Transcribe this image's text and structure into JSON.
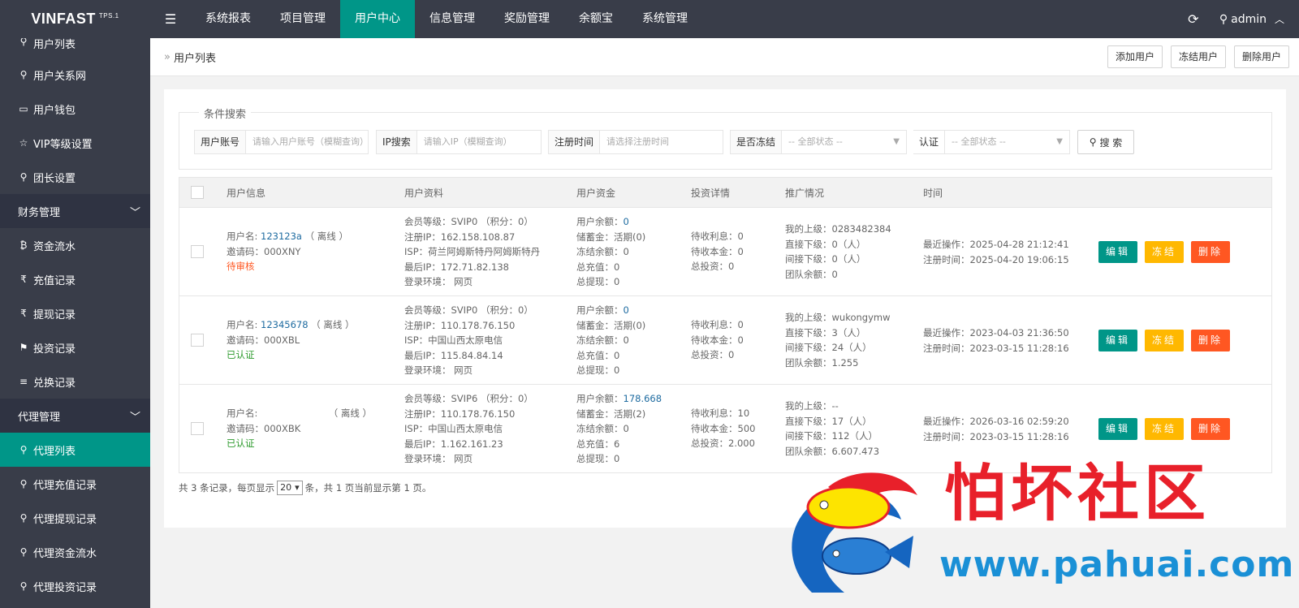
{
  "brand": {
    "name": "VINFAST",
    "version": "TPS.1"
  },
  "topnav": {
    "items": [
      "系统报表",
      "项目管理",
      "用户中心",
      "信息管理",
      "奖励管理",
      "余额宝",
      "系统管理"
    ],
    "active_index": 2,
    "user": "admin"
  },
  "sidebar": {
    "items": [
      {
        "label": "用户列表",
        "icon": "user-icon"
      },
      {
        "label": "用户关系网",
        "icon": "users-icon"
      },
      {
        "label": "用户钱包",
        "icon": "wallet-icon"
      },
      {
        "label": "VIP等级设置",
        "icon": "star-icon"
      },
      {
        "label": "团长设置",
        "icon": "users-icon"
      }
    ],
    "group1": "财务管理",
    "group1_items": [
      {
        "label": "资金流水",
        "icon": "bitcoin-icon"
      },
      {
        "label": "充值记录",
        "icon": "rupee-icon"
      },
      {
        "label": "提现记录",
        "icon": "rupee-icon"
      },
      {
        "label": "投资记录",
        "icon": "flag-icon"
      },
      {
        "label": "兑换记录",
        "icon": "list-icon"
      }
    ],
    "group2": "代理管理",
    "group2_items": [
      {
        "label": "代理列表",
        "icon": "user-icon"
      },
      {
        "label": "代理充值记录",
        "icon": "user-icon"
      },
      {
        "label": "代理提现记录",
        "icon": "user-icon"
      },
      {
        "label": "代理资金流水",
        "icon": "user-icon"
      },
      {
        "label": "代理投资记录",
        "icon": "user-icon"
      }
    ]
  },
  "breadcrumb": {
    "sep": "»",
    "current": "用户列表"
  },
  "actions": {
    "add": "添加用户",
    "freeze": "冻结用户",
    "delete": "删除用户"
  },
  "search": {
    "title": "条件搜索",
    "account_label": "用户账号",
    "account_placeholder": "请输入用户账号（模糊查询）",
    "ip_label": "IP搜索",
    "ip_placeholder": "请输入IP（模糊查询）",
    "regtime_label": "注册时间",
    "regtime_placeholder": "请选择注册时间",
    "frozen_label": "是否冻结",
    "frozen_value": "-- 全部状态 --",
    "auth_label": "认证",
    "auth_value": "-- 全部状态 --",
    "button": "搜 索"
  },
  "table": {
    "headers": [
      "用户信息",
      "用户资料",
      "用户资金",
      "投资详情",
      "推广情况",
      "时间"
    ],
    "rows": [
      {
        "user": {
          "name_label": "用户名:",
          "name": "123123a",
          "online": "（ 离线 ）",
          "invite": "邀请码：000XNY",
          "status": "待审核",
          "status_type": "warn"
        },
        "profile": [
          "会员等级：SVIP0 （积分：0）",
          "注册IP：162.158.108.87",
          "ISP：荷兰阿姆斯特丹阿姆斯特丹",
          "最后IP：172.71.82.138",
          "登录环境： 网页"
        ],
        "funds": {
          "balance_label": "用户余额：",
          "balance": "0",
          "lines": [
            "储蓄金：活期(0)",
            "冻结余额：0",
            "总充值：0",
            "总提现：0"
          ]
        },
        "invest": [
          "待收利息：0",
          "待收本金：0",
          "总投资：0"
        ],
        "promo": [
          "我的上级：0283482384",
          "直接下级：0（人）",
          "间接下级：0（人）",
          "团队余额：0"
        ],
        "time": [
          "最近操作：2025-04-28 21:12:41",
          "注册时间：2025-04-20 19:06:15"
        ]
      },
      {
        "user": {
          "name_label": "用户名:",
          "name": "12345678",
          "online": "（ 离线 ）",
          "invite": "邀请码：000XBL",
          "status": "已认证",
          "status_type": "ok"
        },
        "profile": [
          "会员等级：SVIP0 （积分：0）",
          "注册IP：110.178.76.150",
          "ISP：中国山西太原电信",
          "最后IP：115.84.84.14",
          "登录环境： 网页"
        ],
        "funds": {
          "balance_label": "用户余额：",
          "balance": "0",
          "lines": [
            "储蓄金：活期(0)",
            "冻结余额：0",
            "总充值：0",
            "总提现：0"
          ]
        },
        "invest": [
          "待收利息：0",
          "待收本金：0",
          "总投资：0"
        ],
        "promo": [
          "我的上级：wukongymw",
          "直接下级：3（人）",
          "间接下级：24（人）",
          "团队余额：1.255"
        ],
        "time": [
          "最近操作：2023-04-03 21:36:50",
          "注册时间：2023-03-15 11:28:16"
        ]
      },
      {
        "user": {
          "name_label": "用户名:",
          "name": "",
          "online": "（ 离线 ）",
          "invite": "邀请码：000XBK",
          "status": "已认证",
          "status_type": "ok"
        },
        "profile": [
          "会员等级：SVIP6 （积分：0）",
          "注册IP：110.178.76.150",
          "ISP：中国山西太原电信",
          "最后IP：1.162.161.23",
          "登录环境： 网页"
        ],
        "funds": {
          "balance_label": "用户余额：",
          "balance": "178.668",
          "lines": [
            "储蓄金：活期(2)",
            "冻结余额：0",
            "总充值：6",
            "总提现：0"
          ]
        },
        "invest": [
          "待收利息：10",
          "待收本金：500",
          "总投资：2.000"
        ],
        "promo": [
          "我的上级：--",
          "直接下级：17（人）",
          "间接下级：112（人）",
          "团队余额：6.607.473"
        ],
        "time": [
          "最近操作：2026-03-16 02:59:20",
          "注册时间：2023-03-15 11:28:16"
        ]
      }
    ],
    "row_actions": {
      "edit": "编辑",
      "freeze": "冻结",
      "delete": "删除"
    }
  },
  "pager": {
    "prefix": "共 3 条记录，每页显示",
    "per_page": "20",
    "suffix": "条，共 1 页当前显示第 1 页。"
  },
  "watermark": {
    "title": "怕坏社区",
    "url": "www.pahuai.com"
  },
  "colors": {
    "accent": "#009688",
    "dark": "#393D49",
    "warn": "#FF5722",
    "freeze": "#FFB800",
    "link": "#1E6BA0"
  }
}
